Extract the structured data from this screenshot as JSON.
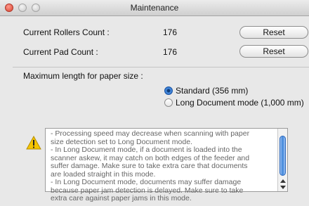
{
  "window": {
    "title": "Maintenance"
  },
  "counts": {
    "rollers": {
      "label": "Current Rollers Count :",
      "value": "176",
      "button_label": "Reset"
    },
    "pad": {
      "label": "Current Pad Count :",
      "value": "176",
      "button_label": "Reset"
    }
  },
  "paper_size": {
    "label": "Maximum length for paper size :",
    "options": [
      {
        "label": "Standard (356 mm)",
        "selected": true
      },
      {
        "label": "Long Document mode (1,000 mm)",
        "selected": false
      }
    ]
  },
  "warning": {
    "icon": "warning-icon",
    "lines": [
      "- Processing speed may decrease when scanning with paper",
      "size detection set to Long Document mode.",
      "- In Long Document mode, if a document is loaded into the",
      "scanner askew, it may catch on both edges of the feeder and",
      "suffer damage. Make sure to take extra care that documents",
      "are loaded straight in this mode.",
      "- In Long Document mode, documents may suffer damage",
      "because paper jam detection is delayed. Make sure to take",
      "extra care against paper jams in this mode."
    ]
  },
  "colors": {
    "accent": "#2a6fc9",
    "warning": "#f5c400",
    "close_button": "#d8432e"
  }
}
